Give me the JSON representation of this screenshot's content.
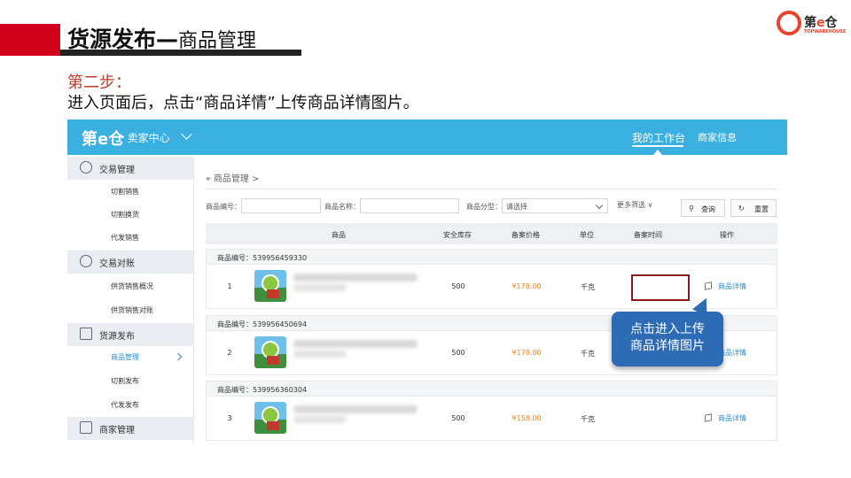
{
  "slide": {
    "title_main": "货源发布—",
    "title_sub": "商品管理",
    "step_label": "第二步：",
    "step_desc": "进入页面后，点击“商品详情”上传商品详情图片。",
    "logo_text_1": "第",
    "logo_text_e": "e",
    "logo_text_2": "仓",
    "logo_sub": "TOPWAREHOUSE",
    "accent": "#d0021b"
  },
  "app": {
    "brand": "第e仓",
    "brand_sub": "· 卖家中心",
    "nav_workbench": "我的工作台",
    "nav_merchant": "商家信息",
    "topbar_color": "#3ab0e0"
  },
  "sidebar": {
    "groups": [
      {
        "label": "交易管理",
        "icon": "yen-circle-icon",
        "items": [
          "切割销售",
          "切割换货",
          "代发销售"
        ]
      },
      {
        "label": "交易对账",
        "icon": "yen-circle-icon",
        "items": [
          "供货销售概况",
          "供货销售对账"
        ]
      },
      {
        "label": "货源发布",
        "icon": "edit-square-icon",
        "items": [
          "商品管理",
          "切割发布",
          "代发发布"
        ]
      },
      {
        "label": "商家管理",
        "icon": "store-icon",
        "items": []
      }
    ],
    "active_item": "商品管理"
  },
  "main": {
    "breadcrumb": "商品管理 >",
    "filters": {
      "product_code_label": "商品编号：",
      "product_name_label": "商品名称：",
      "category_label": "商品分型：",
      "category_value": "请选择",
      "more_filter": "更多筛选 ∨",
      "query_button": "查询",
      "reset_button": "重置"
    },
    "columns": [
      "商品",
      "安全库存",
      "备案价格",
      "单位",
      "备案时间",
      "操作"
    ],
    "rows": [
      {
        "header": "商品编号：539956459330",
        "index": "1",
        "stock": "500",
        "price": "¥178.00",
        "unit": "千克",
        "time": "",
        "action": "商品详情"
      },
      {
        "header": "商品编号：539956450694",
        "index": "2",
        "stock": "500",
        "price": "¥178.00",
        "unit": "千克",
        "time": "",
        "action": "商品详情"
      },
      {
        "header": "商品编号：539956360304",
        "index": "3",
        "stock": "500",
        "price": "¥158.00",
        "unit": "千克",
        "time": "",
        "action": "商品详情"
      }
    ]
  },
  "callout": {
    "line1": "点击进入上传",
    "line2": "商品详情图片",
    "color": "#2d6cb5"
  }
}
